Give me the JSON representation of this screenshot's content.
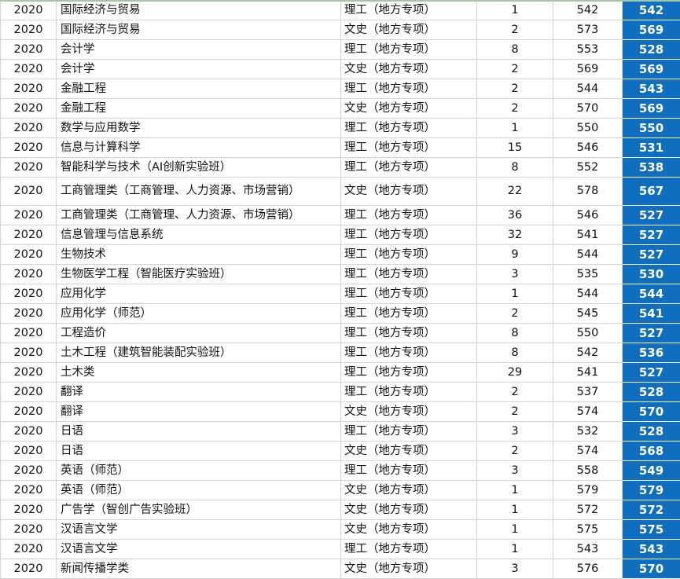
{
  "rows": [
    {
      "year": "2020",
      "major": "国际经济与贸易",
      "type": "理工（地方专项）",
      "count": "1",
      "max": "542",
      "min": "542"
    },
    {
      "year": "2020",
      "major": "国际经济与贸易",
      "type": "文史（地方专项）",
      "count": "2",
      "max": "573",
      "min": "569"
    },
    {
      "year": "2020",
      "major": "会计学",
      "type": "理工（地方专项）",
      "count": "8",
      "max": "553",
      "min": "528"
    },
    {
      "year": "2020",
      "major": "会计学",
      "type": "文史（地方专项）",
      "count": "2",
      "max": "569",
      "min": "569"
    },
    {
      "year": "2020",
      "major": "金融工程",
      "type": "理工（地方专项）",
      "count": "2",
      "max": "544",
      "min": "543"
    },
    {
      "year": "2020",
      "major": "金融工程",
      "type": "文史（地方专项）",
      "count": "2",
      "max": "570",
      "min": "569"
    },
    {
      "year": "2020",
      "major": "数学与应用数学",
      "type": "理工（地方专项）",
      "count": "1",
      "max": "550",
      "min": "550"
    },
    {
      "year": "2020",
      "major": "信息与计算科学",
      "type": "理工（地方专项）",
      "count": "15",
      "max": "546",
      "min": "531"
    },
    {
      "year": "2020",
      "major": "智能科学与技术（AI创新实验班）",
      "type": "理工（地方专项）",
      "count": "8",
      "max": "552",
      "min": "538"
    },
    {
      "year": "2020",
      "major": "工商管理类（工商管理、人力资源、市场营销）",
      "type": "文史（地方专项）",
      "count": "22",
      "max": "578",
      "min": "567",
      "tall": true
    },
    {
      "year": "2020",
      "major": "工商管理类（工商管理、人力资源、市场营销）",
      "type": "理工（地方专项）",
      "count": "36",
      "max": "546",
      "min": "527"
    },
    {
      "year": "2020",
      "major": "信息管理与信息系统",
      "type": "理工（地方专项）",
      "count": "32",
      "max": "541",
      "min": "527"
    },
    {
      "year": "2020",
      "major": "生物技术",
      "type": "理工（地方专项）",
      "count": "9",
      "max": "544",
      "min": "527"
    },
    {
      "year": "2020",
      "major": "生物医学工程（智能医疗实验班）",
      "type": "理工（地方专项）",
      "count": "3",
      "max": "535",
      "min": "530"
    },
    {
      "year": "2020",
      "major": "应用化学",
      "type": "理工（地方专项）",
      "count": "1",
      "max": "544",
      "min": "544"
    },
    {
      "year": "2020",
      "major": "应用化学（师范）",
      "type": "理工（地方专项）",
      "count": "2",
      "max": "545",
      "min": "541"
    },
    {
      "year": "2020",
      "major": "工程造价",
      "type": "理工（地方专项）",
      "count": "8",
      "max": "550",
      "min": "527"
    },
    {
      "year": "2020",
      "major": "土木工程（建筑智能装配实验班）",
      "type": "理工（地方专项）",
      "count": "8",
      "max": "542",
      "min": "536"
    },
    {
      "year": "2020",
      "major": "土木类",
      "type": "理工（地方专项）",
      "count": "29",
      "max": "541",
      "min": "527"
    },
    {
      "year": "2020",
      "major": "翻译",
      "type": "理工（地方专项）",
      "count": "2",
      "max": "537",
      "min": "528"
    },
    {
      "year": "2020",
      "major": "翻译",
      "type": "文史（地方专项）",
      "count": "2",
      "max": "574",
      "min": "570"
    },
    {
      "year": "2020",
      "major": "日语",
      "type": "理工（地方专项）",
      "count": "3",
      "max": "532",
      "min": "528"
    },
    {
      "year": "2020",
      "major": "日语",
      "type": "文史（地方专项）",
      "count": "2",
      "max": "574",
      "min": "568"
    },
    {
      "year": "2020",
      "major": "英语（师范）",
      "type": "理工（地方专项）",
      "count": "3",
      "max": "558",
      "min": "549"
    },
    {
      "year": "2020",
      "major": "英语（师范）",
      "type": "文史（地方专项）",
      "count": "1",
      "max": "579",
      "min": "579"
    },
    {
      "year": "2020",
      "major": "广告学（智创广告实验班）",
      "type": "文史（地方专项）",
      "count": "1",
      "max": "572",
      "min": "572"
    },
    {
      "year": "2020",
      "major": "汉语言文学",
      "type": "文史（地方专项）",
      "count": "1",
      "max": "575",
      "min": "575"
    },
    {
      "year": "2020",
      "major": "汉语言文学",
      "type": "理工（地方专项）",
      "count": "1",
      "max": "543",
      "min": "543"
    },
    {
      "year": "2020",
      "major": "新闻传播学类",
      "type": "文史（地方专项）",
      "count": "3",
      "max": "576",
      "min": "570"
    }
  ],
  "colors": {
    "highlight": "#0f6ebd",
    "grid": "#d4d4d4",
    "top_accent": "#9dc9a9"
  }
}
